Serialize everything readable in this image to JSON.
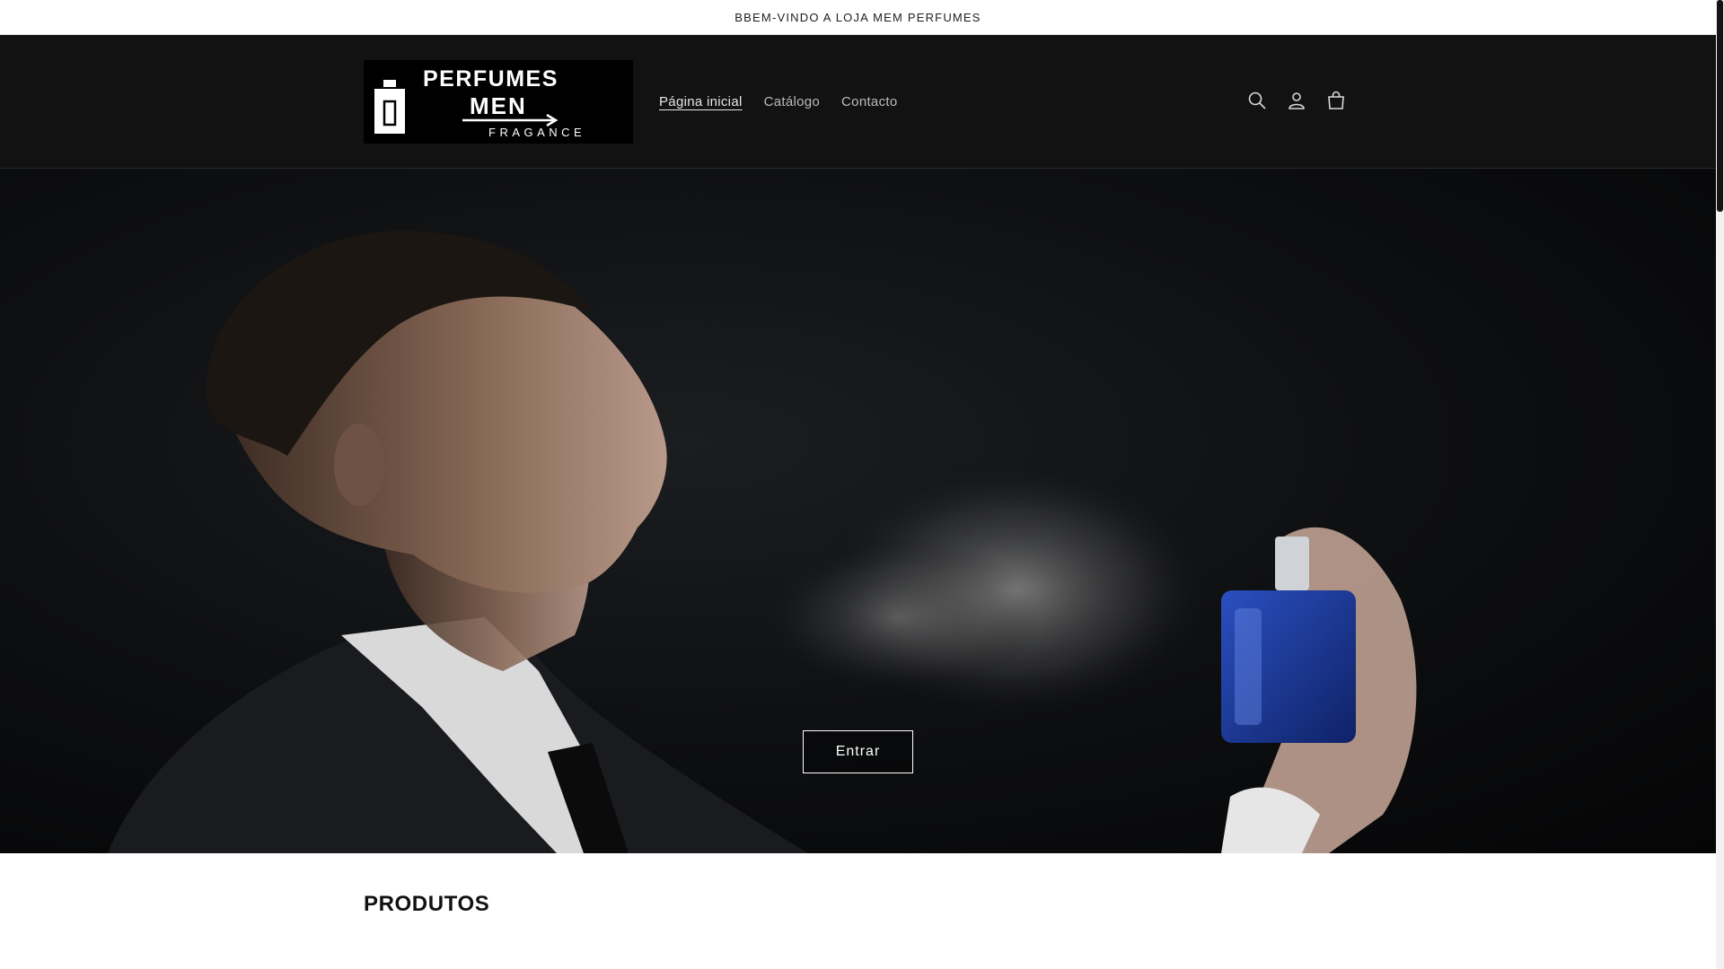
{
  "announcement": {
    "text": "BBEM-VINDO A LOJA MEM PERFUMES"
  },
  "logo": {
    "line1": "PERFUMES",
    "line2": "MEN",
    "line3": "FRAGANCE"
  },
  "nav": {
    "items": [
      {
        "label": "Página inicial",
        "active": true
      },
      {
        "label": "Catálogo",
        "active": false
      },
      {
        "label": "Contacto",
        "active": false
      }
    ]
  },
  "header_icons": [
    "search-icon",
    "account-icon",
    "cart-icon"
  ],
  "hero": {
    "button_label": "Entrar"
  },
  "products": {
    "title": "PRODUTOS"
  },
  "colors": {
    "header_bg": "#121212",
    "hero_bg": "#0d0e10",
    "text_dark": "#121212",
    "perfume_blue": "#1c3c9c"
  }
}
